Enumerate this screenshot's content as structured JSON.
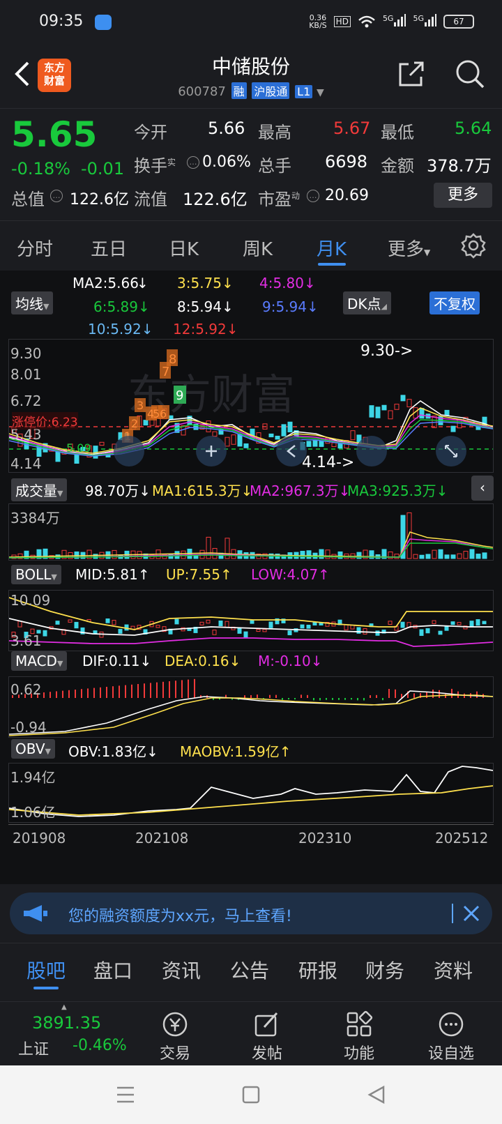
{
  "status_bar": {
    "time": "09:35",
    "net_speed_top": "0.36",
    "net_speed_bottom": "KB/S",
    "hd": "HD",
    "sig1": "5G",
    "sig2": "5G",
    "battery": "67"
  },
  "header": {
    "title": "中储股份",
    "code": "600787",
    "tag_rong": "融",
    "tag_hgt": "沪股通",
    "tag_level": "L1",
    "logo_line1": "东方",
    "logo_line2": "财富"
  },
  "quote": {
    "price": "5.65",
    "change_pct": "-0.18%",
    "change": "-0.01",
    "open_label": "今开",
    "open": "5.66",
    "high_label": "最高",
    "high": "5.67",
    "low_label": "最低",
    "low": "5.64",
    "turnover_label": "换手",
    "turnover_sup": "实",
    "turnover": "0.06%",
    "volume_label": "总手",
    "volume": "6698",
    "amount_label": "金额",
    "amount": "378.7万",
    "mktcap_label": "总值",
    "mktcap": "122.6亿",
    "float_label": "流值",
    "float": "122.6亿",
    "pe_label": "市盈",
    "pe_sup": "动",
    "pe": "20.69",
    "more_btn": "更多"
  },
  "tabs": [
    "分时",
    "五日",
    "日K",
    "周K",
    "月K",
    "更多"
  ],
  "ma": {
    "selector": "均线",
    "ma2": "MA2:5.66",
    "ma3": "3:5.75",
    "ma4": "4:5.80",
    "ma6": "6:5.89",
    "ma8": "8:5.94",
    "ma9": "9:5.94",
    "ma10": "10:5.92",
    "ma12": "12:5.92",
    "dk": "DK点",
    "fq": "不复权"
  },
  "main_chart": {
    "axis_top": "9.30",
    "axis_2": "8.01",
    "axis_3": "6.72",
    "axis_4": "5.43",
    "axis_bottom": "4.14",
    "limit_label": "涨停价:6.23",
    "support": "5.09",
    "high_marker": "9.30->",
    "low_marker": "4.14->",
    "signals": [
      "1",
      "2",
      "3",
      "4",
      "5",
      "6",
      "7",
      "8",
      "9"
    ]
  },
  "volume": {
    "label": "成交量",
    "value": "98.70万",
    "ma1": "MA1:615.3万",
    "ma2": "MA2:967.3万",
    "ma3": "MA3:925.3万",
    "axis_top": "3384万"
  },
  "boll": {
    "label": "BOLL",
    "mid": "MID:5.81",
    "up": "UP:7.55",
    "low": "LOW:4.07",
    "axis_top": "10.09",
    "axis_bottom": "3.61"
  },
  "macd": {
    "label": "MACD",
    "dif": "DIF:0.11",
    "dea": "DEA:0.16",
    "m": "M:-0.10",
    "axis_top": "0.62",
    "axis_bottom": "-0.94"
  },
  "obv": {
    "label": "OBV",
    "obv": "OBV:1.83亿",
    "maobv": "MAOBV:1.59亿",
    "axis_top": "1.94亿",
    "axis_bottom": "1.06亿"
  },
  "dates": [
    "201908",
    "202108",
    "202310",
    "202512"
  ],
  "banner": {
    "text": "您的融资额度为xx元，马上查看!"
  },
  "bottom_tabs": [
    "股吧",
    "盘口",
    "资讯",
    "公告",
    "研报",
    "财务",
    "资料"
  ],
  "bottom_bar": {
    "index_value": "3891.35",
    "index_name": "上证",
    "index_change": "-0.46%",
    "trade": "交易",
    "post": "发帖",
    "function": "功能",
    "watch": "设自选"
  },
  "colors": {
    "up": "#f23a3a",
    "down": "#19c93c",
    "accent": "#3f8ff0"
  }
}
